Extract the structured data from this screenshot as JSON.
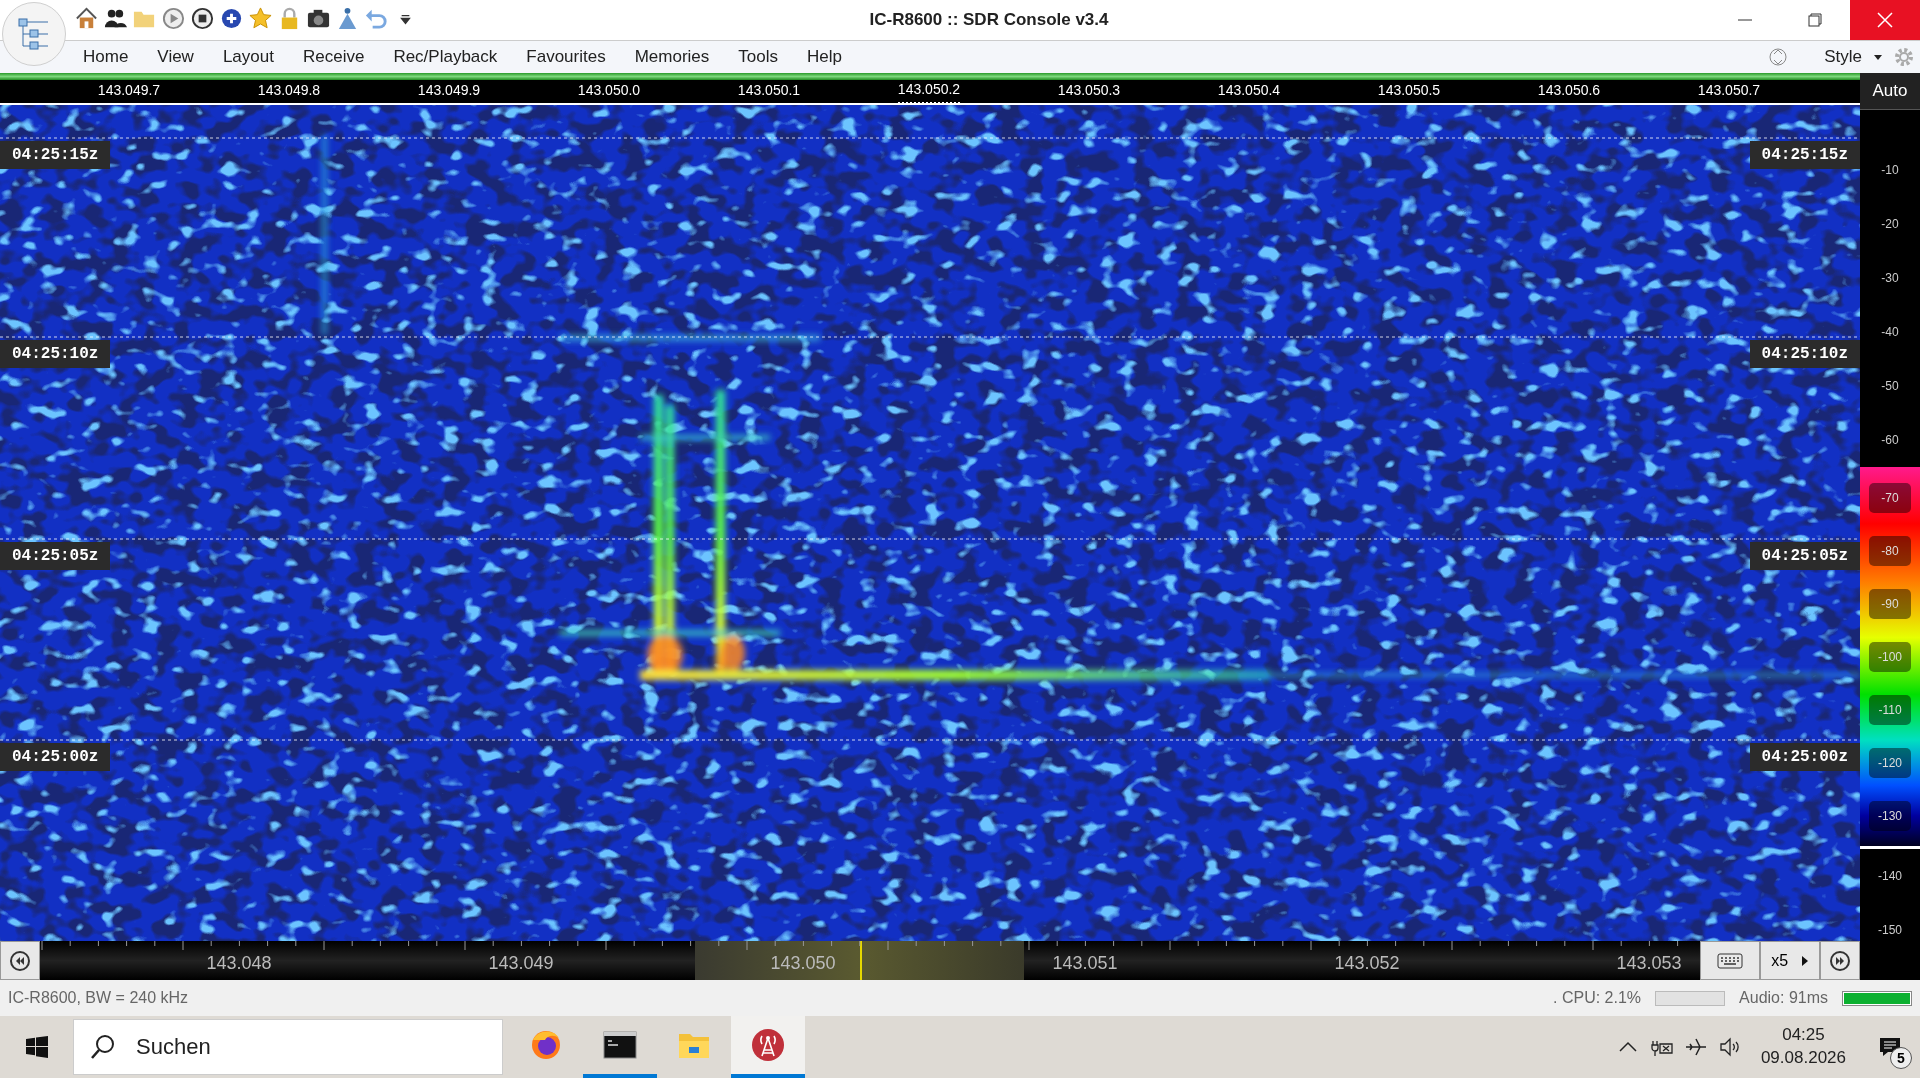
{
  "window": {
    "title": "IC-R8600 :: SDR Console v3.4"
  },
  "menu": [
    "Home",
    "View",
    "Layout",
    "Receive",
    "Rec/Playback",
    "Favourites",
    "Memories",
    "Tools",
    "Help"
  ],
  "style_label": "Style",
  "freq_ruler": [
    {
      "label": "143.049.7",
      "selected": false
    },
    {
      "label": "143.049.8",
      "selected": false
    },
    {
      "label": "143.049.9",
      "selected": false
    },
    {
      "label": "143.050.0",
      "selected": false
    },
    {
      "label": "143.050.1",
      "selected": false
    },
    {
      "label": "143.050.2",
      "selected": true
    },
    {
      "label": "143.050.3",
      "selected": false
    },
    {
      "label": "143.050.4",
      "selected": false
    },
    {
      "label": "143.050.5",
      "selected": false
    },
    {
      "label": "143.050.6",
      "selected": false
    },
    {
      "label": "143.050.7",
      "selected": false
    }
  ],
  "auto_button": "Auto",
  "left_time_labels": [
    "04:25:15z",
    "04:25:10z",
    "04:25:05z",
    "04:25:00z"
  ],
  "right_time_labels": [
    "04:25:15z",
    "04:25:10z",
    "04:25:05z",
    "04:25:00z"
  ],
  "level_scale": [
    {
      "label": "-10",
      "kind": "plain"
    },
    {
      "label": "-20",
      "kind": "plain"
    },
    {
      "label": "-30",
      "kind": "plain"
    },
    {
      "label": "-40",
      "kind": "plain"
    },
    {
      "label": "-50",
      "kind": "plain"
    },
    {
      "label": "-60",
      "kind": "plain"
    },
    {
      "label": "-70",
      "kind": "band"
    },
    {
      "label": "-80",
      "kind": "band"
    },
    {
      "label": "-90",
      "kind": "band"
    },
    {
      "label": "-100",
      "kind": "band"
    },
    {
      "label": "-110",
      "kind": "band"
    },
    {
      "label": "-120",
      "kind": "band"
    },
    {
      "label": "-130",
      "kind": "band"
    },
    {
      "label": "-140",
      "kind": "plain"
    },
    {
      "label": "-150",
      "kind": "plain"
    }
  ],
  "tuning_scale": [
    "143.048",
    "143.049",
    "143.050",
    "143.051",
    "143.052",
    "143.053"
  ],
  "zoom": "x5",
  "status_bar": {
    "device": "IC-R8600, BW = 240 kHz",
    "cpu": ". CPU: 2.1%",
    "audio": "Audio: 91ms",
    "audio_meter": {
      "level": 1.0
    }
  },
  "taskbar": {
    "search": {
      "placeholder": "Suchen"
    },
    "apps": [
      {
        "kind": "browser",
        "open": false,
        "selected": false
      },
      {
        "kind": "terminal",
        "open": true,
        "selected": false
      },
      {
        "kind": "files",
        "open": false,
        "selected": false
      },
      {
        "kind": "radio",
        "open": true,
        "selected": true
      }
    ],
    "time": "04:25",
    "date": "09.08.2026",
    "notifications": "5"
  }
}
